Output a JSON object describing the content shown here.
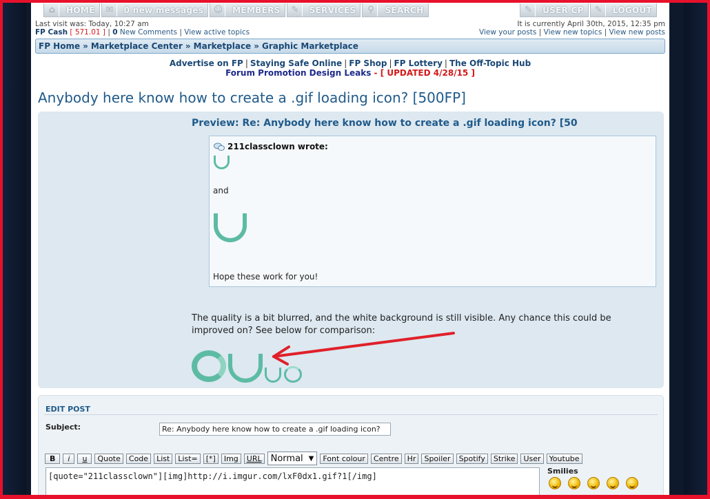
{
  "nav": {
    "left": [
      {
        "icon": "home-icon",
        "label": "HOME"
      },
      {
        "icon": "envelope-icon",
        "label": "0 new messages"
      },
      {
        "icon": "members-icon",
        "label": "MEMBERS"
      },
      {
        "icon": "wrench-icon",
        "label": "SERVICES"
      },
      {
        "icon": "search-icon",
        "label": "SEARCH"
      }
    ],
    "right": [
      {
        "icon": "wrench-icon",
        "label": "USER CP"
      },
      {
        "icon": "wrench-icon",
        "label": "LOGOUT"
      }
    ]
  },
  "info": {
    "last_visit": "Last visit was: Today, 10:27 am",
    "fp_cash_label": "FP Cash",
    "fp_cash_value": "[ 571.01 ]",
    "new_comments_count": "0",
    "new_comments_label": "New Comments",
    "view_active": "View active topics",
    "current_time": "It is currently April 30th, 2015, 12:35 pm",
    "view_posts": "View your posts",
    "view_new_topics": "View new topics",
    "view_new_posts": "View new posts"
  },
  "breadcrumb": [
    "FP Home",
    "Marketplace Center",
    "Marketplace",
    "Graphic Marketplace"
  ],
  "links": {
    "row1": [
      "Advertise on FP",
      "Staying Safe Online",
      "FP Shop",
      "FP Lottery",
      "The Off-Topic Hub"
    ],
    "leaks": "Forum Promotion Design Leaks",
    "dash": "-",
    "updated": "[ UPDATED 4/28/15 ]"
  },
  "topic_title": "Anybody here know how to create a .gif loading icon? [500FP]",
  "preview": {
    "heading": "Preview: Re: Anybody here know how to create a .gif loading icon? [50",
    "quote_author": "211classclown wrote:",
    "quote_and": "and",
    "quote_hope": "Hope these work for you!",
    "body": "The quality is a bit blurred, and the white background is still visible. Any chance this could be improved on? See below for comparison:"
  },
  "edit": {
    "heading": "EDIT POST",
    "subject_label": "Subject:",
    "subject_value": "Re: Anybody here know how to create a .gif loading icon?",
    "toolbar": [
      "B",
      "i",
      "u",
      "Quote",
      "Code",
      "List",
      "List=",
      "[*]",
      "Img",
      "URL"
    ],
    "font_size": "Normal",
    "toolbar2": [
      "Font colour",
      "Centre",
      "Hr",
      "Spoiler",
      "Spotify",
      "Strike",
      "User",
      "Youtube"
    ],
    "message_value": "[quote=\"211classclown\"][img]http://i.imgur.com/lxF0dx1.gif?1[/img]",
    "smilies_label": "Smilies"
  },
  "colors": {
    "accent": "#1f5a8a",
    "ring": "#5dbba4",
    "arrow": "#e0202a",
    "frame": "#e8112b"
  }
}
